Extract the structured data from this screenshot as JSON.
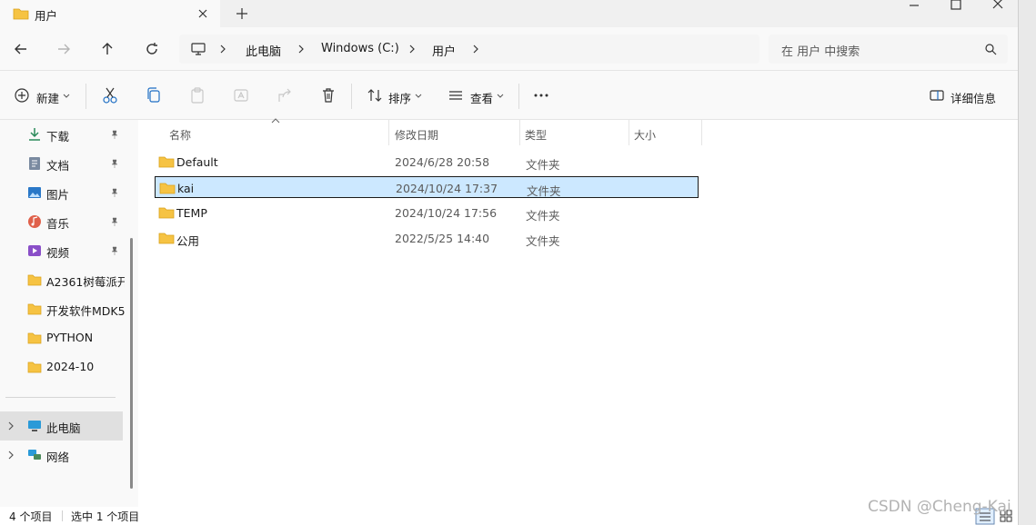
{
  "window": {
    "tab_title": "用户",
    "min_icon": "minimize-icon",
    "max_icon": "maximize-icon",
    "close_icon": "close-icon"
  },
  "address_bar": {
    "crumbs": [
      "此电脑",
      "Windows (C:)",
      "用户"
    ],
    "search_placeholder": "在 用户 中搜索"
  },
  "commands": {
    "new_label": "新建",
    "sort_label": "排序",
    "view_label": "查看",
    "details_label": "详细信息"
  },
  "nav_pane": {
    "quick": [
      {
        "label": "下载",
        "icon": "download-icon"
      },
      {
        "label": "文档",
        "icon": "document-icon"
      },
      {
        "label": "图片",
        "icon": "pictures-icon"
      },
      {
        "label": "音乐",
        "icon": "music-icon"
      },
      {
        "label": "视频",
        "icon": "video-icon"
      },
      {
        "label": "A2361树莓派开",
        "icon": "folder-icon"
      },
      {
        "label": "开发软件MDK5",
        "icon": "folder-icon"
      },
      {
        "label": "PYTHON",
        "icon": "folder-icon"
      },
      {
        "label": "2024-10",
        "icon": "folder-icon"
      }
    ],
    "this_pc": "此电脑",
    "network": "网络"
  },
  "file_list": {
    "columns": [
      "名称",
      "修改日期",
      "类型",
      "大小"
    ],
    "rows": [
      {
        "name": "Default",
        "date": "2024/6/28 20:58",
        "type": "文件夹"
      },
      {
        "name": "kai",
        "date": "2024/10/24 17:37",
        "type": "文件夹"
      },
      {
        "name": "TEMP",
        "date": "2024/10/24 17:56",
        "type": "文件夹"
      },
      {
        "name": "公用",
        "date": "2022/5/25 14:40",
        "type": "文件夹"
      }
    ],
    "selected_index": 1
  },
  "status": {
    "item_count": "4 个项目",
    "selected": "选中 1 个项目"
  },
  "watermark": "CSDN @Cheng-Kai",
  "colors": {
    "folder": "#f6c343",
    "selection": "#cce8ff",
    "accent": "#0067c0"
  }
}
